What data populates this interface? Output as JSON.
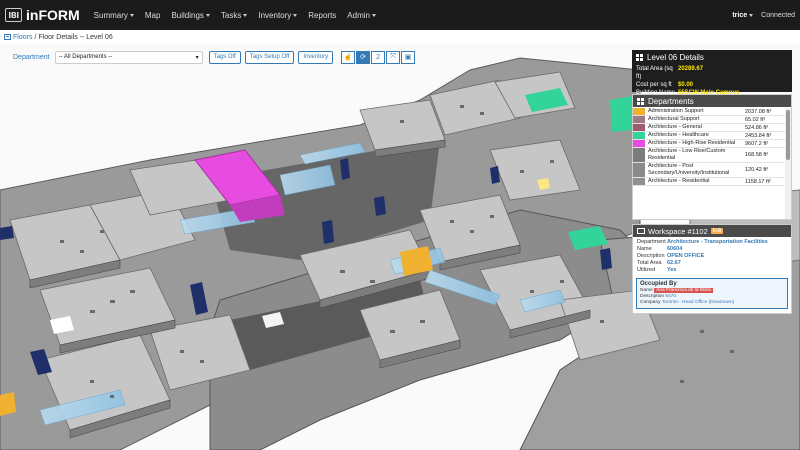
{
  "app": {
    "logo_text": "IBI",
    "name": "inFORM"
  },
  "nav": {
    "items": [
      {
        "label": "Summary",
        "caret": true
      },
      {
        "label": "Map",
        "caret": false
      },
      {
        "label": "Buildings",
        "caret": true
      },
      {
        "label": "Tasks",
        "caret": true
      },
      {
        "label": "Inventory",
        "caret": true
      },
      {
        "label": "Reports",
        "caret": false
      },
      {
        "label": "Admin",
        "caret": true
      }
    ],
    "user": "trice",
    "status": "Connected"
  },
  "breadcrumb": {
    "link": "Floors",
    "separator": "/",
    "current": "Floor Details -- Level 06"
  },
  "toolbar": {
    "department_label": "Department",
    "department_value": "-- All Departments --",
    "buttons": [
      "Tags Off",
      "Tags Setup Off",
      "Inventory"
    ],
    "icon_buttons": [
      {
        "icon": "hand-icon",
        "glyph": "☝",
        "active": false
      },
      {
        "icon": "rotate-icon",
        "glyph": "⟳",
        "active": true
      },
      {
        "icon": "2d-icon",
        "glyph": "2",
        "active": false
      },
      {
        "icon": "fit-icon",
        "glyph": "⤧",
        "active": false
      },
      {
        "icon": "save-icon",
        "glyph": "▣",
        "active": false
      }
    ]
  },
  "level_details": {
    "title": "Level 06 Details",
    "rows": [
      {
        "key": "Total Area (sq ft)",
        "value": "20289.67"
      },
      {
        "key": "Cost per sq ft",
        "value": "$0.00"
      },
      {
        "key": "Building Name",
        "value": "55SCW Main Campus"
      }
    ]
  },
  "departments": {
    "title": "Departments",
    "items": [
      {
        "name": "Administration Support",
        "area": "2037.08 ft²",
        "color": "#f0b030"
      },
      {
        "name": "Architectural Support",
        "area": "65.02 ft²",
        "color": "#9e7a86"
      },
      {
        "name": "Architecture - General",
        "area": "524.86 ft²",
        "color": "#a05a6a"
      },
      {
        "name": "Architecture - Healthcare",
        "area": "2453.84 ft²",
        "color": "#33d49a"
      },
      {
        "name": "Architecture - High-Rise Residential",
        "area": "9607.2 ft²",
        "color": "#e64ce0"
      },
      {
        "name": "Architecture - Low Rise/Custom Residential",
        "area": "168.58 ft²",
        "color": "#7c7c7c"
      },
      {
        "name": "Architecture - Post Secondary/University/Institutional",
        "area": "120.42 ft²",
        "color": "#8a8a8a"
      },
      {
        "name": "Architecture - Residential",
        "area": "1158.17 ft²",
        "color": "#8f8f8f"
      }
    ]
  },
  "workspace": {
    "title": "Workspace #1102",
    "edit_label": "Edit",
    "rows": [
      {
        "key": "Department",
        "value": "Architecture - Transportation Facilities"
      },
      {
        "key": "Name",
        "value": "60604"
      },
      {
        "key": "Description",
        "value": "OPEN OFFICE"
      },
      {
        "key": "Total Area",
        "value": "62.67"
      },
      {
        "key": "Utilized",
        "value": "Yes"
      }
    ],
    "occupied": {
      "title": "Occupied By",
      "name_key": "Name",
      "name_value": "Ana Francisca de la Mora",
      "desc_key": "Description",
      "desc_value": "6470",
      "company_key": "Company",
      "company_value": "Toronto - Head Office (Downtown)"
    }
  },
  "colors": {
    "navbar": "#1b1b1b",
    "accent": "#337ab7",
    "highlight": "#ffe600",
    "magenta": "#e64ce0",
    "teal": "#33d49a",
    "navy": "#1f2f6a"
  }
}
